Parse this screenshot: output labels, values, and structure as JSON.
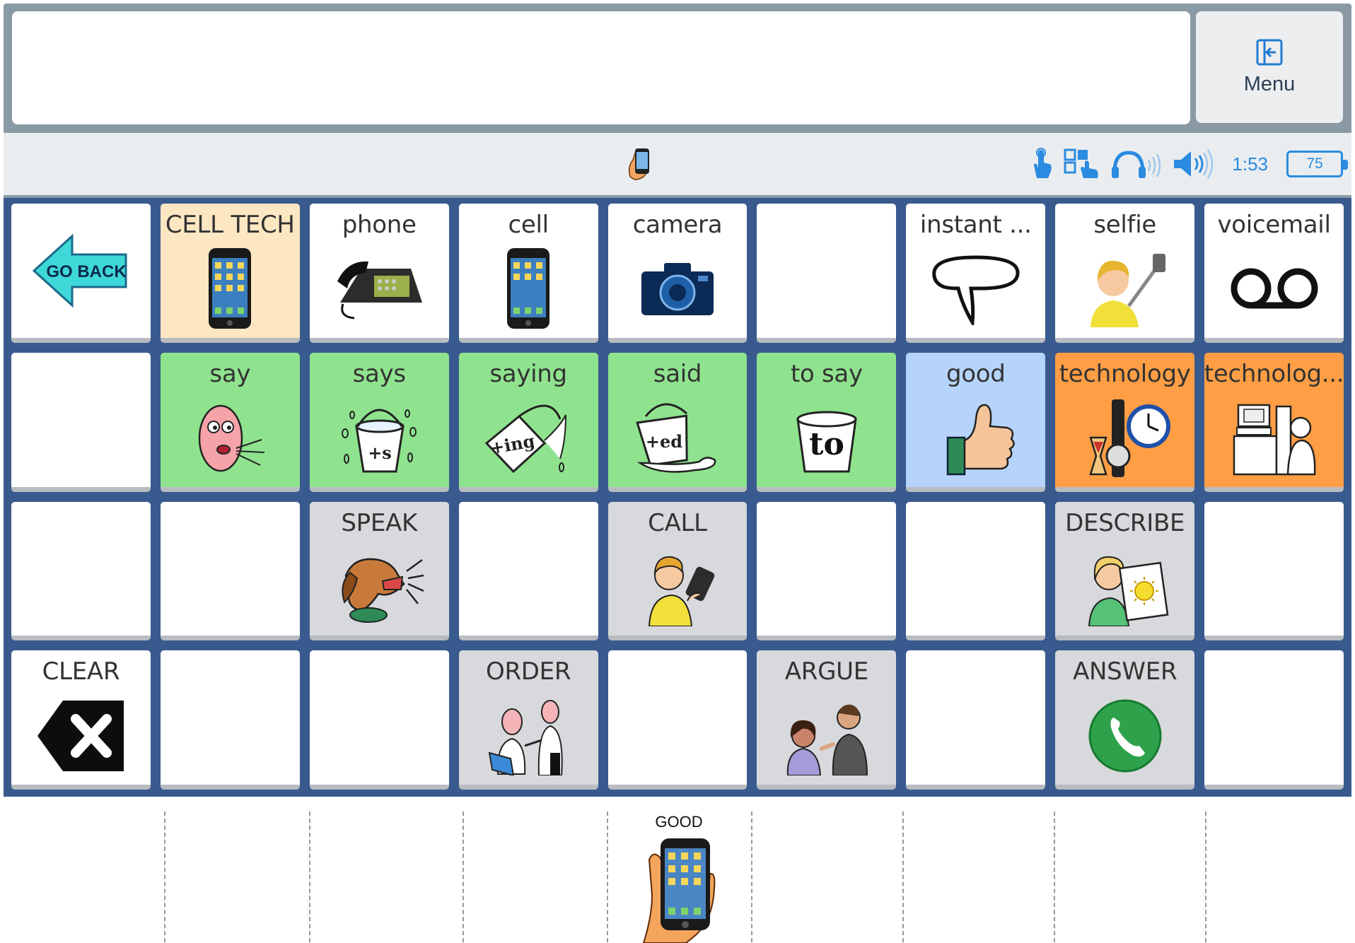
{
  "menu": {
    "label": "Menu"
  },
  "status": {
    "time": "1:53",
    "battery": "75"
  },
  "grid": {
    "r0": [
      "GO BACK",
      "CELL TECH",
      "phone",
      "cell",
      "camera",
      "",
      "instant ...",
      "selfie",
      "voicemail"
    ],
    "r1": [
      "",
      "say",
      "says",
      "saying",
      "said",
      "to say",
      "good",
      "technology",
      "technolog..."
    ],
    "r2": [
      "",
      "",
      "SPEAK",
      "",
      "CALL",
      "",
      "",
      "DESCRIBE",
      ""
    ],
    "r3": [
      "CLEAR",
      "",
      "",
      "ORDER",
      "",
      "ARGUE",
      "",
      "ANSWER",
      ""
    ]
  },
  "bottom": {
    "word": "GOOD"
  },
  "colors": {
    "frame": "#395a8e",
    "green": "#8fe38e",
    "orange": "#ff9e45",
    "blue": "#b6d4fb",
    "tan": "#fde7c3",
    "grey": "#d7d9dc"
  }
}
